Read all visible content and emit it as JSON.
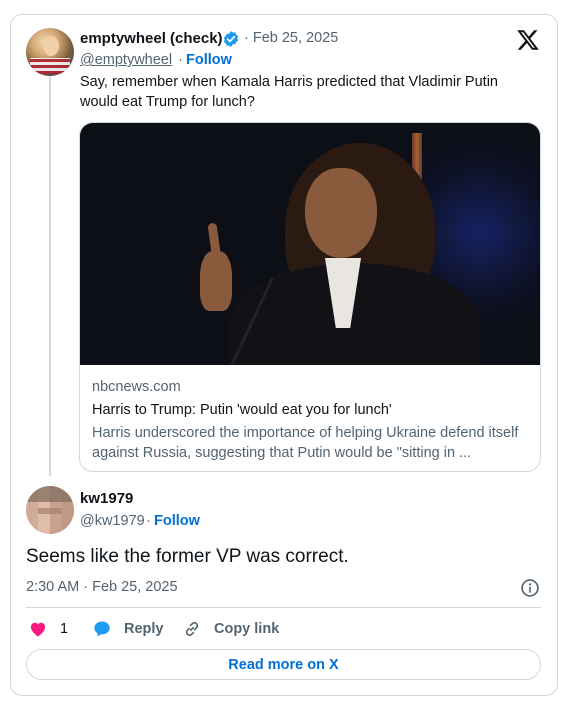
{
  "colors": {
    "accent": "#006fd6",
    "like": "#f91880",
    "muted": "#536471",
    "border": "#cfd9de",
    "verified": "#1d9bf0"
  },
  "quoted": {
    "name": "emptywheel (check)",
    "handle": "@emptywheel",
    "date": "· Feb 25, 2025",
    "follow": "Follow",
    "dot": "·",
    "text": "Say, remember when Kamala Harris predicted that Vladimir Putin would eat Trump for lunch?",
    "verified_icon": "verified-badge-icon",
    "link": {
      "domain": "nbcnews.com",
      "title": "Harris to Trump: Putin 'would eat you for lunch'",
      "description": "Harris underscored the importance of helping Ukraine defend itself against Russia, suggesting that Putin would be \"sitting in ..."
    }
  },
  "reply": {
    "name": "kw1979",
    "handle": "@kw1979",
    "dot": "·",
    "follow": "Follow",
    "text": "Seems like the former VP was correct.",
    "timestamp": "2:30 AM · Feb 25, 2025"
  },
  "actions": {
    "like_count": "1",
    "reply_label": "Reply",
    "copy_label": "Copy link"
  },
  "read_more": "Read more on X",
  "icons": [
    "x-logo-icon",
    "verified-badge-icon",
    "info-icon",
    "heart-icon",
    "reply-bubble-icon",
    "link-icon"
  ]
}
